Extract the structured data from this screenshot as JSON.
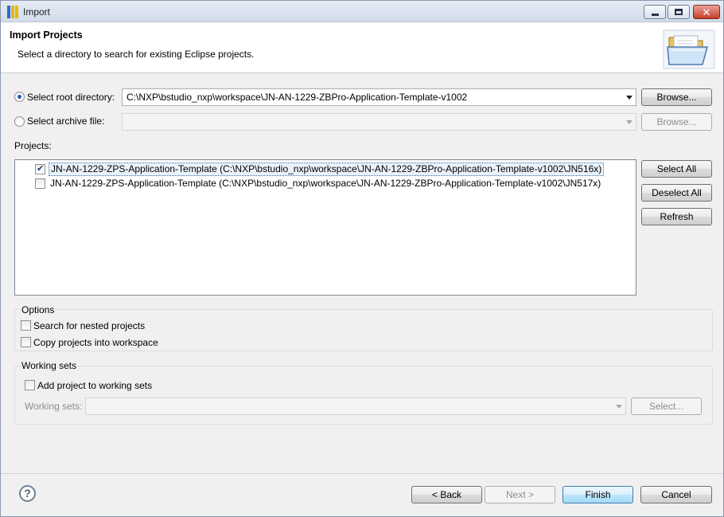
{
  "window": {
    "title": "Import"
  },
  "banner": {
    "title": "Import Projects",
    "subtitle": "Select a directory to search for existing Eclipse projects."
  },
  "source": {
    "root_label": "Select root directory:",
    "root_value": "C:\\NXP\\bstudio_nxp\\workspace\\JN-AN-1229-ZBPro-Application-Template-v1002",
    "archive_label": "Select archive file:",
    "archive_value": "",
    "browse_label": "Browse...",
    "browse_archive_label": "Browse..."
  },
  "projects": {
    "label": "Projects:",
    "items": [
      {
        "text": "JN-AN-1229-ZPS-Application-Template (C:\\NXP\\bstudio_nxp\\workspace\\JN-AN-1229-ZBPro-Application-Template-v1002\\JN516x)",
        "checked": true
      },
      {
        "text": "JN-AN-1229-ZPS-Application-Template (C:\\NXP\\bstudio_nxp\\workspace\\JN-AN-1229-ZBPro-Application-Template-v1002\\JN517x)",
        "checked": false
      }
    ],
    "select_all": "Select All",
    "deselect_all": "Deselect All",
    "refresh": "Refresh"
  },
  "options": {
    "title": "Options",
    "nested": "Search for nested projects",
    "copy": "Copy projects into workspace"
  },
  "working_sets": {
    "title": "Working sets",
    "add": "Add project to working sets",
    "field_label": "Working sets:",
    "select_button": "Select..."
  },
  "footer": {
    "help": "?",
    "back": "< Back",
    "next": "Next >",
    "finish": "Finish",
    "cancel": "Cancel"
  },
  "icons": {
    "window": "eclipse-app-icon",
    "banner": "open-folder-icon",
    "help": "help-icon"
  }
}
